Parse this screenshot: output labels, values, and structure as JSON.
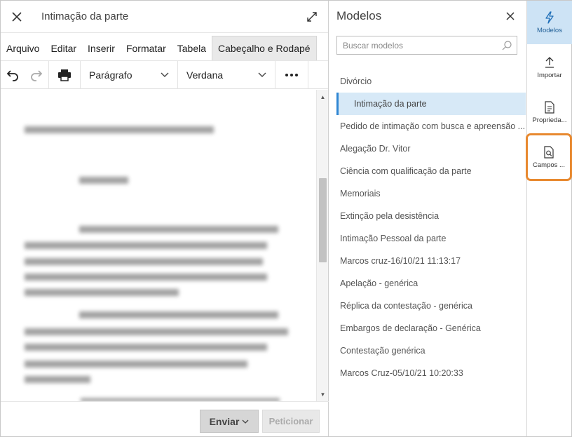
{
  "editor": {
    "title": "Intimação da parte",
    "menu": [
      "Arquivo",
      "Editar",
      "Inserir",
      "Formatar",
      "Tabela",
      "Cabeçalho e Rodapé"
    ],
    "toolbar": {
      "paragraph_style": "Parágrafo",
      "font": "Verdana"
    },
    "footer": {
      "send_label": "Enviar",
      "petition_label": "Peticionar"
    }
  },
  "models": {
    "title": "Modelos",
    "search_placeholder": "Buscar modelos",
    "items": [
      "Divórcio",
      "Intimação da parte",
      "Pedido de intimação com busca e apreensão ...",
      "Alegação Dr. Vitor",
      "Ciência com qualificação da parte",
      "Memoriais",
      "Extinção pela desistência",
      "Intimação Pessoal da parte",
      "Marcos cruz-16/10/21 11:13:17",
      "Apelação - genérica",
      "Réplica da contestação - genérica",
      "Embargos de declaração - Genérica",
      "Contestação genérica",
      "Marcos Cruz-05/10/21 10:20:33"
    ],
    "selected_index": 1
  },
  "rail": {
    "modelos": "Modelos",
    "importar": "Importar",
    "propriedades": "Proprieda...",
    "campos": "Campos ..."
  },
  "colors": {
    "accent": "#2f86d3",
    "selected_bg": "#d7e9f7",
    "highlight": "#e8892f"
  }
}
